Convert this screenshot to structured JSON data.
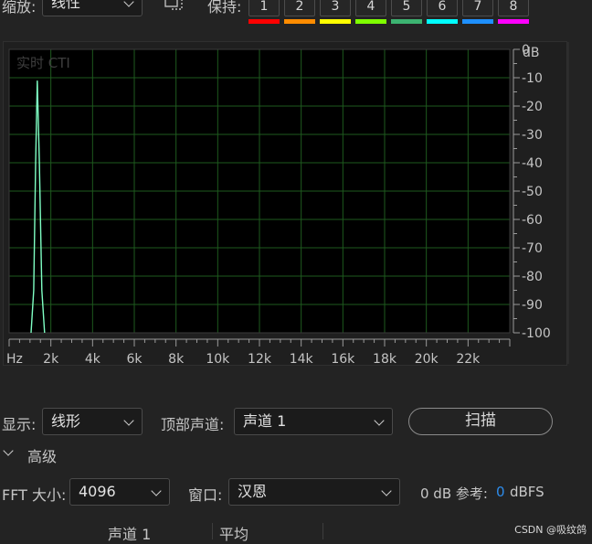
{
  "toolbar": {
    "scale_label": "缩放:",
    "scale_value": "线性",
    "hold_label": "保持:",
    "hold_buttons": [
      {
        "label": "1",
        "color": "#ff0000"
      },
      {
        "label": "2",
        "color": "#ff8c00"
      },
      {
        "label": "3",
        "color": "#ffff00"
      },
      {
        "label": "4",
        "color": "#7fff00"
      },
      {
        "label": "5",
        "color": "#3cb371"
      },
      {
        "label": "6",
        "color": "#00ffff"
      },
      {
        "label": "7",
        "color": "#1e90ff"
      },
      {
        "label": "8",
        "color": "#ff00ff"
      }
    ]
  },
  "plot": {
    "overlay_label": "实时 CTI",
    "db_unit": "dB",
    "hz_unit": "Hz",
    "line_color": "#7fffc4"
  },
  "chart_data": {
    "type": "line",
    "title": "",
    "xlabel": "Hz",
    "ylabel": "dB",
    "x_ticks": [
      "2k",
      "4k",
      "6k",
      "8k",
      "10k",
      "12k",
      "14k",
      "16k",
      "18k",
      "20k",
      "22k"
    ],
    "y_ticks": [
      "0",
      "-10",
      "-20",
      "-30",
      "-40",
      "-50",
      "-60",
      "-70",
      "-80",
      "-90",
      "-100"
    ],
    "xlim": [
      0,
      24000
    ],
    "ylim": [
      -100,
      0
    ],
    "grid": true,
    "series": [
      {
        "x": [
          1050,
          1180,
          1270,
          1350,
          1450,
          1570,
          1700
        ],
        "y": [
          -100,
          -85,
          -40,
          -11,
          -40,
          -85,
          -100
        ]
      }
    ]
  },
  "display": {
    "show_label": "显示:",
    "show_value": "线形",
    "top_channel_label": "顶部声道:",
    "top_channel_value": "声道 1",
    "scan_label": "扫描"
  },
  "advanced": {
    "label": "高级",
    "fft_label": "FFT 大小:",
    "fft_value": "4096",
    "window_label": "窗口:",
    "window_value": "汉恩",
    "ref_label": "0 dB 参考:",
    "ref_value": "0",
    "ref_unit": "dBFS",
    "ref_value_color": "#2d8ceb"
  },
  "table_header": [
    "声道 1",
    "平均"
  ],
  "watermark": "CSDN @吸纹鸽"
}
